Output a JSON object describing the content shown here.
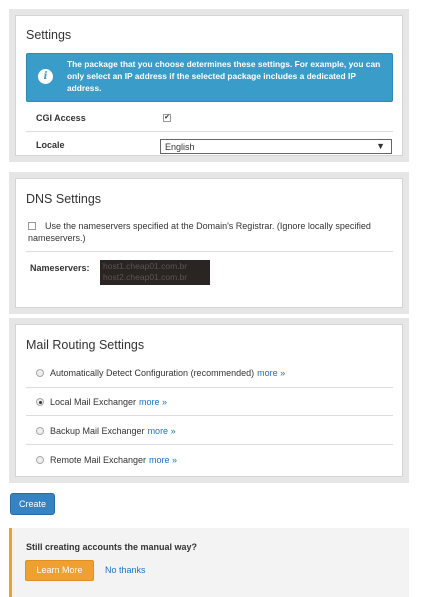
{
  "settings": {
    "title": "Settings",
    "info_text": "The package that you choose determines these settings. For example, you can only select an IP address if the selected package includes a dedicated IP address.",
    "cgi_label": "CGI Access",
    "cgi_checked": true,
    "cgi_check_glyph": "✔",
    "locale_label": "Locale",
    "locale_value": "English",
    "locale_arrow": "▼"
  },
  "dns": {
    "title": "DNS Settings",
    "use_registrar_label": "Use the nameservers specified at the Domain's Registrar. (Ignore locally specified nameservers.)",
    "use_registrar_checked": false,
    "nameservers_label": "Nameservers:",
    "ns1": "host1.cheap01.com.br",
    "ns2": "host2.cheap01.com.br"
  },
  "mail": {
    "title": "Mail Routing Settings",
    "more_label": "more »",
    "options": [
      {
        "label": "Automatically Detect Configuration (recommended)",
        "selected": false
      },
      {
        "label": "Local Mail Exchanger",
        "selected": true
      },
      {
        "label": "Backup Mail Exchanger",
        "selected": false
      },
      {
        "label": "Remote Mail Exchanger",
        "selected": false
      }
    ]
  },
  "create_label": "Create",
  "promo": {
    "title": "Still creating accounts the manual way?",
    "learn_more": "Learn More",
    "no_thanks": "No thanks",
    "accent_color": "#f0a030"
  },
  "colors": {
    "info_bg": "#3a9cc8",
    "primary": "#3683c4",
    "link": "#1a73c8"
  }
}
